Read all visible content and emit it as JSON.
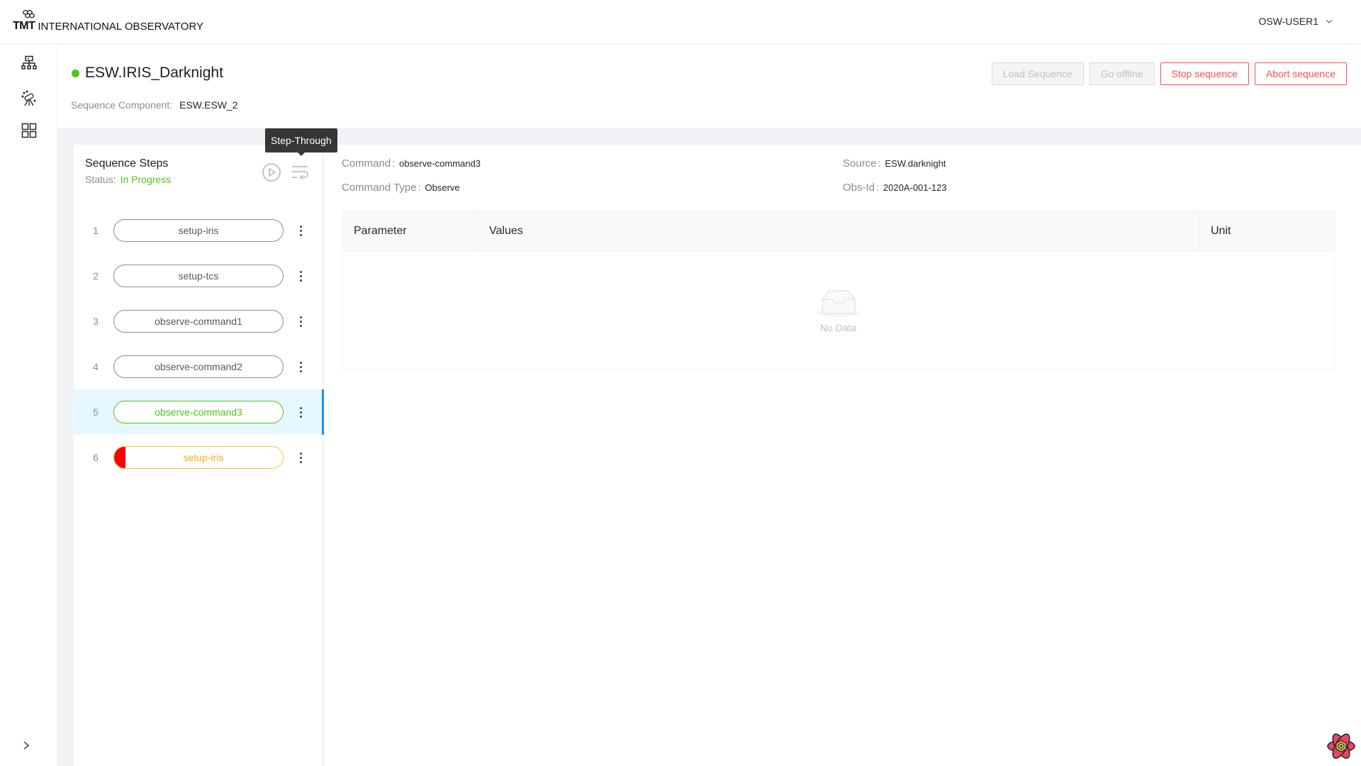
{
  "header": {
    "logo_mark": "TMT",
    "org_name": "INTERNATIONAL OBSERVATORY",
    "user": "OSW-USER1",
    "user_menu_icon": "chevron-down-icon"
  },
  "nav_rail": {
    "items": [
      {
        "icon": "infrastructure-icon"
      },
      {
        "icon": "telescope-icon"
      },
      {
        "icon": "apps-grid-icon"
      }
    ],
    "expand_icon": "chevron-right-icon",
    "expand_glyph": ">"
  },
  "page": {
    "status_color": "#52c41a",
    "title": "ESW.IRIS_Darknight",
    "sequence_component_label": "Sequence Component:",
    "sequence_component_value": "ESW.ESW_2",
    "actions": [
      {
        "label": "Load Sequence",
        "state": "disabled"
      },
      {
        "label": "Go offline",
        "state": "disabled"
      },
      {
        "label": "Stop sequence",
        "state": "danger"
      },
      {
        "label": "Abort sequence",
        "state": "danger"
      }
    ]
  },
  "steps_panel": {
    "title": "Sequence Steps",
    "status_label": "Status:",
    "status_value": "In Progress",
    "play_icon": "play-circle-icon",
    "step_through_icon": "step-through-icon",
    "tooltip": "Step-Through",
    "steps": [
      {
        "index": "1",
        "name": "setup-iris",
        "state": "pending"
      },
      {
        "index": "2",
        "name": "setup-tcs",
        "state": "pending"
      },
      {
        "index": "3",
        "name": "observe-command1",
        "state": "pending"
      },
      {
        "index": "4",
        "name": "observe-command2",
        "state": "pending"
      },
      {
        "index": "5",
        "name": "observe-command3",
        "state": "in-progress",
        "selected": true
      },
      {
        "index": "6",
        "name": "setup-iris",
        "state": "breakpoint"
      }
    ]
  },
  "details": {
    "command_label": "Command",
    "command_value": "observe-command3",
    "command_type_label": "Command Type",
    "command_type_value": "Observe",
    "source_label": "Source",
    "source_value": "ESW.darknight",
    "obsid_label": "Obs-Id",
    "obsid_value": "2020A-001-123",
    "separator": ":",
    "table": {
      "columns": [
        "Parameter",
        "Values",
        "Unit"
      ],
      "rows": [],
      "empty_text": "No Data"
    }
  },
  "colors": {
    "success": "#52c41a",
    "danger": "#ff4d4f",
    "warning": "#faad14",
    "selected_bg": "#e6f7ff",
    "selected_bar": "#1890ff",
    "breakpoint": "#ff0000"
  }
}
